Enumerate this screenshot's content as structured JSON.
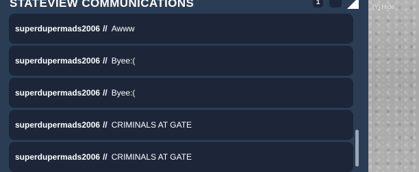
{
  "header": {
    "title": "STATEVIEW COMMUNICATIONS",
    "count": "1"
  },
  "messages": [
    {
      "user": "superdupermads2006",
      "sep": "//",
      "text": "Awww"
    },
    {
      "user": "superdupermads2006",
      "sep": "//",
      "text": "Byee:("
    },
    {
      "user": "superdupermads2006",
      "sep": "//",
      "text": "Byee:("
    },
    {
      "user": "superdupermads2006",
      "sep": "//",
      "text": "CRIMINALS AT GATE"
    },
    {
      "user": "superdupermads2006",
      "sep": "//",
      "text": "CRIMINALS AT GATE"
    }
  ],
  "hide_hint": "[Y] Hide",
  "colors": {
    "panel": "#2a3d55",
    "message_bg": "#1c2638",
    "text": "#ffffff",
    "scroll_thumb": "#9aa6b6"
  }
}
